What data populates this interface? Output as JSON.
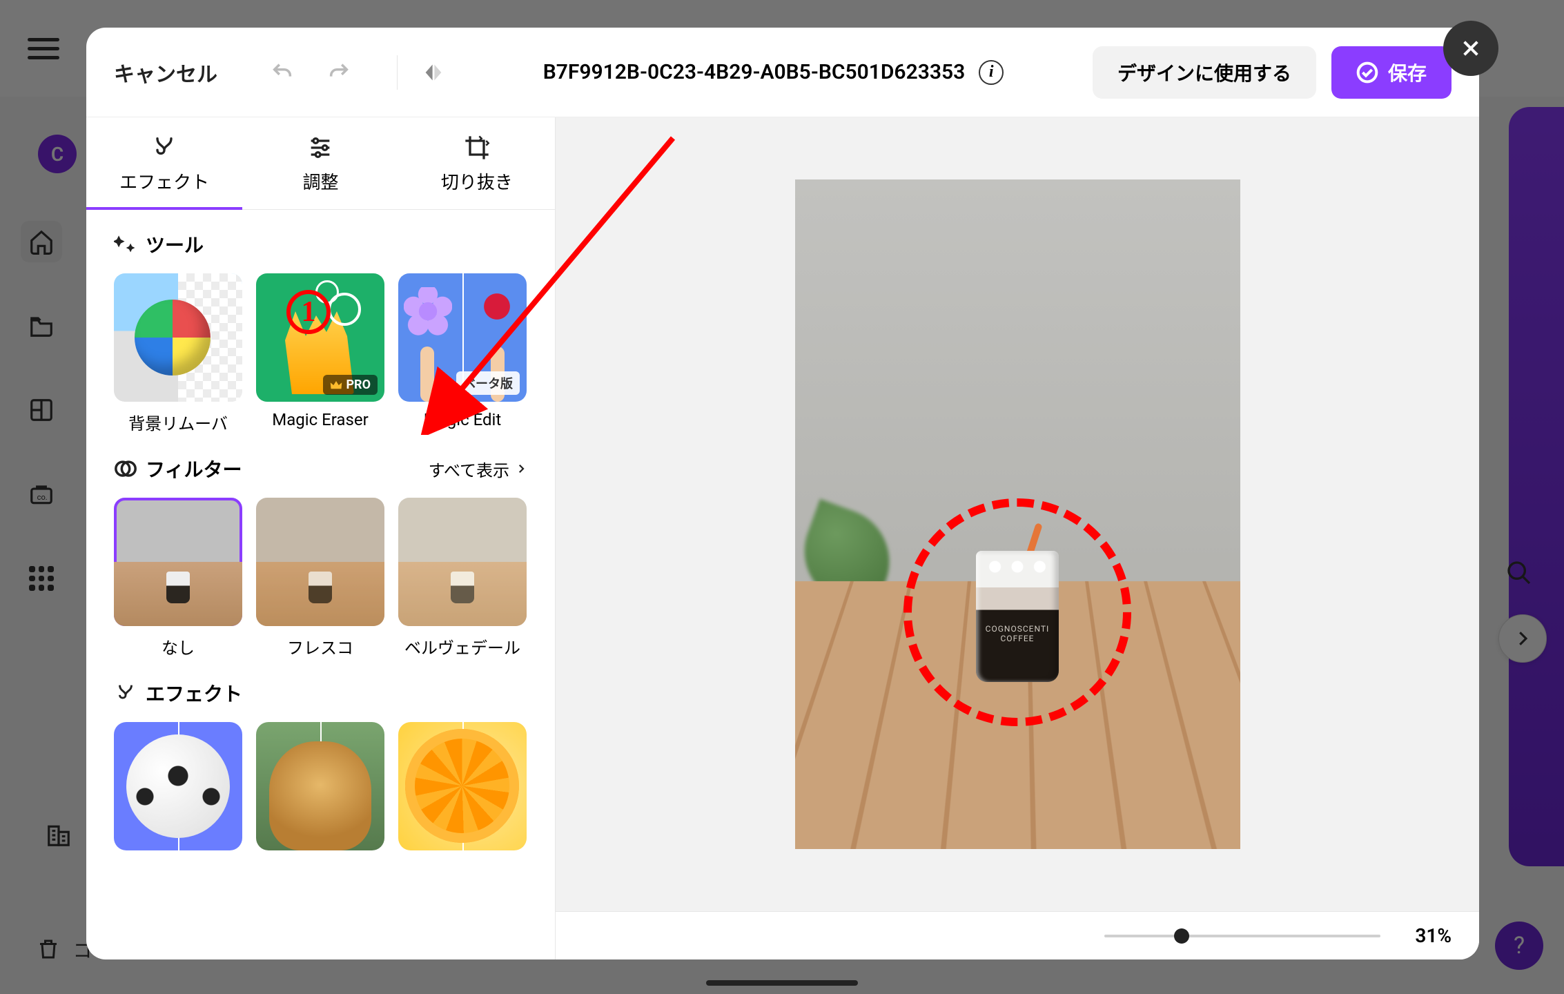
{
  "header": {
    "cancel": "キャンセル",
    "title": "B7F9912B-0C23-4B29-A0B5-BC501D623353",
    "use_in_design": "デザインに使用する",
    "save": "保存"
  },
  "tabs": {
    "effects": "エフェクト",
    "adjust": "調整",
    "crop": "切り抜き"
  },
  "sections": {
    "tools": "ツール",
    "filters": "フィルター",
    "see_all": "すべて表示",
    "effects": "エフェクト"
  },
  "tools": {
    "bg_remover": "背景リムーバ",
    "magic_eraser": "Magic Eraser",
    "magic_edit": "Magic Edit",
    "pro_badge": "PRO",
    "beta_badge": "ベータ版"
  },
  "filters": {
    "none": "なし",
    "fresco": "フレスコ",
    "belvedere": "ベルヴェデール"
  },
  "canvas": {
    "cup_brand_top": "COGNOSCENTI",
    "cup_brand_bottom": "COFFEE",
    "zoom": "31%"
  },
  "leftbar": {
    "trash": "ゴミ箱"
  },
  "annotations": {
    "number": "1"
  }
}
